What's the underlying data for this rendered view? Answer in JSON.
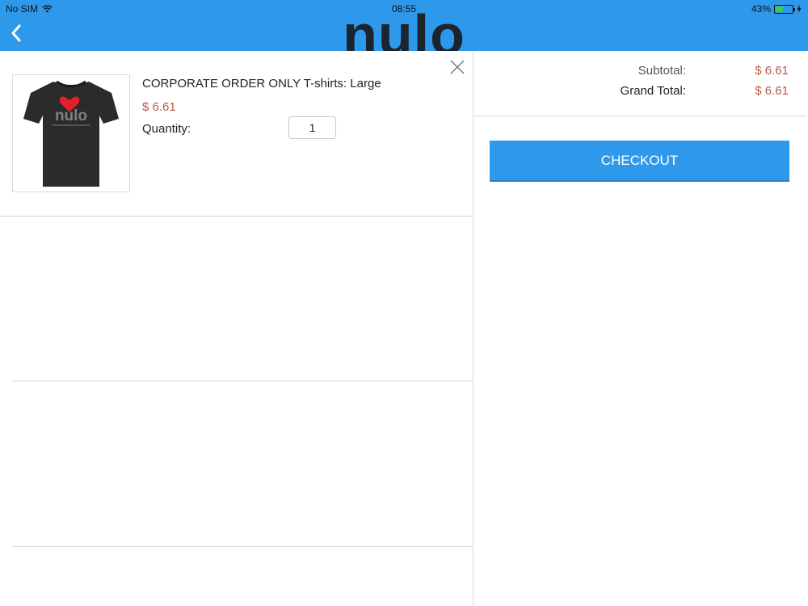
{
  "status_bar": {
    "carrier": "No SIM",
    "time": "08:55",
    "battery": "43%",
    "battery_level": 0.43,
    "wifi_icon": "wifi-icon",
    "charging_icon": "charging-bolt-icon"
  },
  "header": {
    "logo_text": "nulo",
    "back_icon": "chevron-left-icon",
    "background_color": "#2e99ea"
  },
  "cart": {
    "items": [
      {
        "name": "CORPORATE ORDER ONLY T-shirts: Large",
        "price": "$ 6.61",
        "quantity_label": "Quantity:",
        "quantity": "1",
        "image_icon": "tshirt-image",
        "image_logo_text": "nulo",
        "remove_icon": "close-icon"
      }
    ]
  },
  "summary": {
    "subtotal_label": "Subtotal:",
    "subtotal_value": "$ 6.61",
    "grand_total_label": "Grand Total:",
    "grand_total_value": "$ 6.61",
    "checkout_label": "CHECKOUT"
  },
  "colors": {
    "accent": "#2e99ea",
    "price": "#b35b45"
  }
}
